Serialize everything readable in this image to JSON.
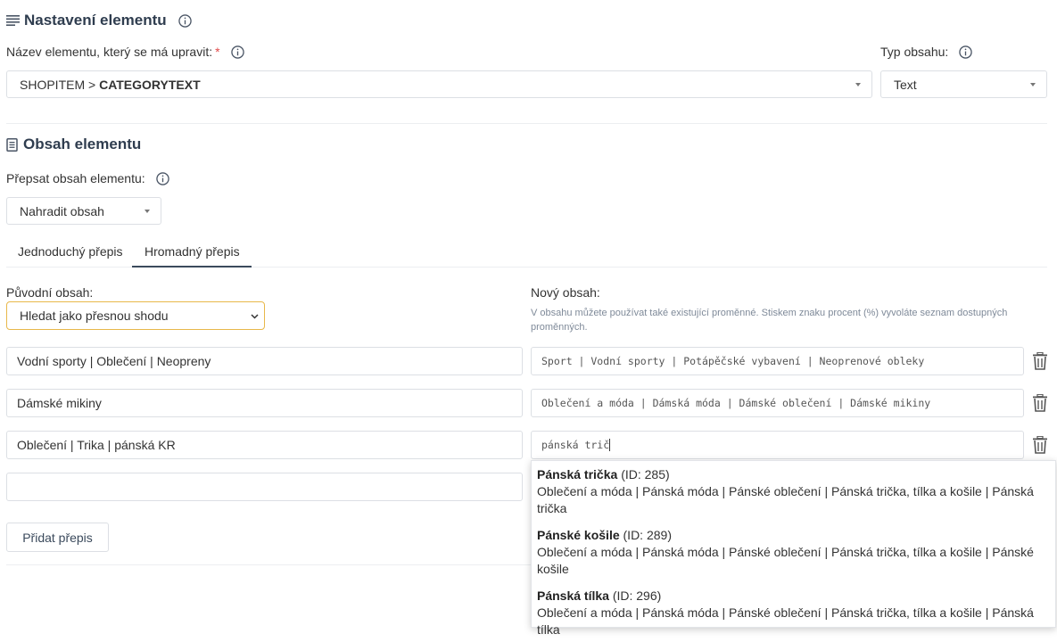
{
  "settings": {
    "title": "Nastavení elementu",
    "element_label": "Název elementu, který se má upravit:",
    "required_mark": "*",
    "element_value_prefix": "SHOPITEM > ",
    "element_value_bold": "CATEGORYTEXT",
    "type_label": "Typ obsahu:",
    "type_value": "Text"
  },
  "content": {
    "title": "Obsah elementu",
    "overwrite_label": "Přepsat obsah elementu:",
    "overwrite_value": "Nahradit obsah",
    "tabs": [
      {
        "label": "Jednoduchý přepis",
        "active": false
      },
      {
        "label": "Hromadný přepis",
        "active": true
      }
    ],
    "original_label": "Původní obsah:",
    "match_mode": "Hledat jako přesnou shodu",
    "new_label": "Nový obsah:",
    "hint": "V obsahu můžete používat také existující proměnné. Stiskem znaku procent (%) vyvoláte seznam dostupných proměnných.",
    "rows": [
      {
        "original": "Vodní sporty | Oblečení | Neopreny",
        "new": "Sport | Vodní sporty | Potápěčské vybavení | Neoprenové obleky"
      },
      {
        "original": "Dámské mikiny",
        "new": "Oblečení a móda | Dámská móda | Dámské oblečení | Dámské mikiny"
      },
      {
        "original": "Oblečení | Trika | pánská KR",
        "new": "pánská trič"
      },
      {
        "original": "",
        "new": ""
      }
    ],
    "add_button": "Přidat přepis"
  },
  "suggestions": [
    {
      "name": "Pánská trička",
      "id": "(ID: 285)",
      "path": "Oblečení a móda | Pánská móda | Pánské oblečení | Pánská trička, tílka a košile | Pánská trička"
    },
    {
      "name": "Pánské košile",
      "id": "(ID: 289)",
      "path": "Oblečení a móda | Pánská móda | Pánské oblečení | Pánská trička, tílka a košile | Pánské košile"
    },
    {
      "name": "Pánská tílka",
      "id": "(ID: 296)",
      "path": "Oblečení a móda | Pánská móda | Pánské oblečení | Pánská trička, tílka a košile | Pánská tílka"
    }
  ],
  "icons": {
    "section1": "list-icon",
    "section2": "document-icon",
    "info": "info-icon",
    "trash": "trash-icon"
  },
  "colors": {
    "accent_border": "#e8b84a",
    "tab_active": "#3b4a5c",
    "required": "#e14b4b"
  }
}
